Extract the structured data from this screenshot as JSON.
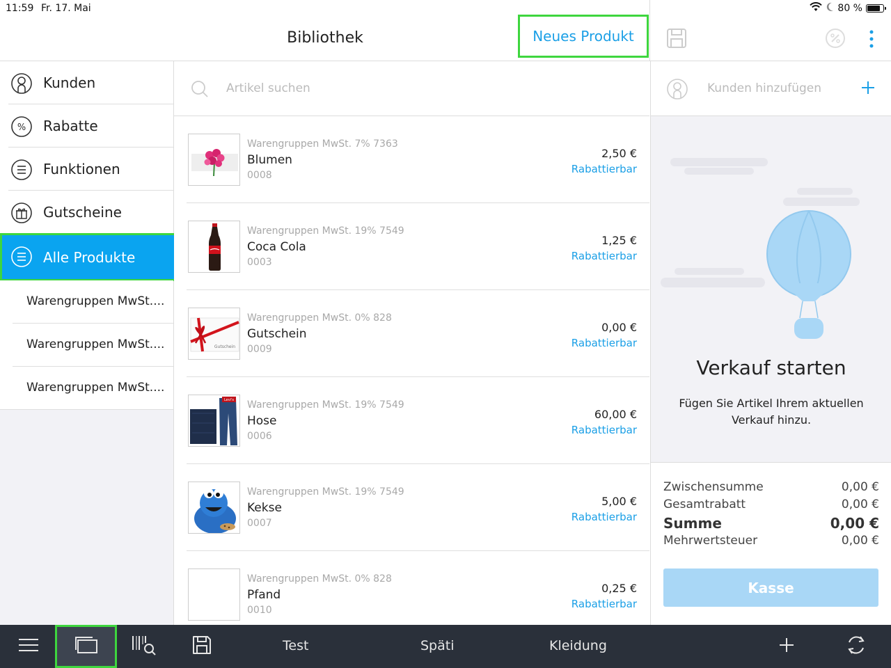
{
  "status": {
    "time": "11:59",
    "date": "Fr. 17. Mai",
    "battery": "80 %",
    "battery_level": 0.8
  },
  "header": {
    "title": "Bibliothek",
    "new_product": "Neues Produkt"
  },
  "sidebar": {
    "items": [
      {
        "label": "Kunden",
        "icon": "user-circle-icon"
      },
      {
        "label": "Rabatte",
        "icon": "percent-icon"
      },
      {
        "label": "Funktionen",
        "icon": "menu-lines-icon"
      },
      {
        "label": "Gutscheine",
        "icon": "gift-icon"
      },
      {
        "label": "Alle Produkte",
        "icon": "menu-lines-icon",
        "active": true
      }
    ],
    "subitems": [
      {
        "label": "Warengruppen MwSt...."
      },
      {
        "label": "Warengruppen MwSt...."
      },
      {
        "label": "Warengruppen MwSt...."
      }
    ]
  },
  "search": {
    "placeholder": "Artikel suchen"
  },
  "products": [
    {
      "group": "Warengruppen MwSt. 7% 7363",
      "name": "Blumen",
      "code": "0008",
      "price": "2,50 €",
      "discount": "Rabattierbar",
      "image": "flowers"
    },
    {
      "group": "Warengruppen MwSt. 19% 7549",
      "name": "Coca Cola",
      "code": "0003",
      "price": "1,25 €",
      "discount": "Rabattierbar",
      "image": "bottle"
    },
    {
      "group": "Warengruppen MwSt. 0% 828",
      "name": "Gutschein",
      "code": "0009",
      "price": "0,00 €",
      "discount": "Rabattierbar",
      "image": "voucher",
      "image_text": "Gutschein"
    },
    {
      "group": "Warengruppen MwSt. 19% 7549",
      "name": "Hose",
      "code": "0006",
      "price": "60,00 €",
      "discount": "Rabattierbar",
      "image": "jeans",
      "image_text": "Levi's"
    },
    {
      "group": "Warengruppen MwSt. 19% 7549",
      "name": "Kekse",
      "code": "0007",
      "price": "5,00 €",
      "discount": "Rabattierbar",
      "image": "cookie-monster"
    },
    {
      "group": "Warengruppen MwSt. 0% 828",
      "name": "Pfand",
      "code": "0010",
      "price": "0,25 €",
      "discount": "Rabattierbar",
      "image": "empty"
    }
  ],
  "cart": {
    "add_customer": "Kunden hinzufügen",
    "empty_title": "Verkauf starten",
    "empty_text": "Fügen Sie Artikel Ihrem aktuellen Verkauf hinzu.",
    "totals": [
      {
        "label": "Zwischensumme",
        "value": "0,00 €"
      },
      {
        "label": "Gesamtrabatt",
        "value": "0,00 €"
      },
      {
        "label": "Summe",
        "value": "0,00 €",
        "bold": true
      },
      {
        "label": "Mehrwertsteuer",
        "value": "0,00 €"
      }
    ],
    "checkout": "Kasse"
  },
  "bottombar": {
    "tabs": [
      "Test",
      "Späti",
      "Kleidung"
    ]
  },
  "colors": {
    "accent": "#0aa4f0",
    "link": "#1a9fe6",
    "highlight": "#3ed63e",
    "bar": "#2a303a",
    "checkout": "#a9d7f6"
  }
}
